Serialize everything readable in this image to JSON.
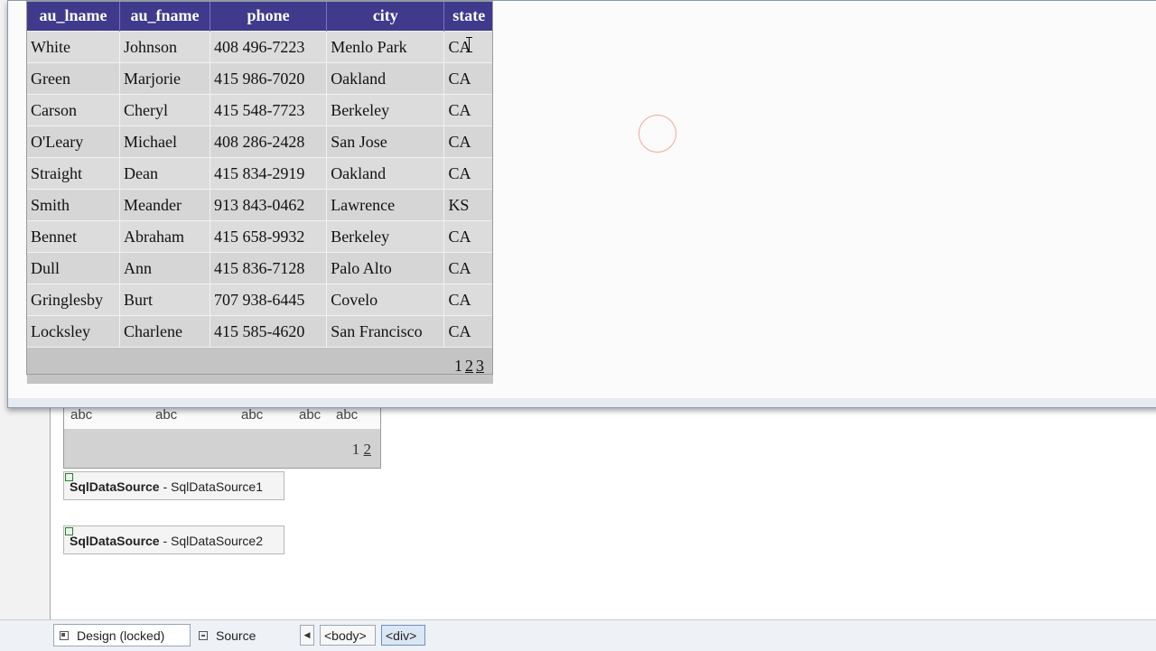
{
  "table": {
    "headers": [
      "au_lname",
      "au_fname",
      "phone",
      "city",
      "state"
    ],
    "rows": [
      [
        "White",
        "Johnson",
        "408 496-7223",
        "Menlo Park",
        "CA"
      ],
      [
        "Green",
        "Marjorie",
        "415 986-7020",
        "Oakland",
        "CA"
      ],
      [
        "Carson",
        "Cheryl",
        "415 548-7723",
        "Berkeley",
        "CA"
      ],
      [
        "O'Leary",
        "Michael",
        "408 286-2428",
        "San Jose",
        "CA"
      ],
      [
        "Straight",
        "Dean",
        "415 834-2919",
        "Oakland",
        "CA"
      ],
      [
        "Smith",
        "Meander",
        "913 843-0462",
        "Lawrence",
        "KS"
      ],
      [
        "Bennet",
        "Abraham",
        "415 658-9932",
        "Berkeley",
        "CA"
      ],
      [
        "Dull",
        "Ann",
        "415 836-7128",
        "Palo Alto",
        "CA"
      ],
      [
        "Gringlesby",
        "Burt",
        "707 938-6445",
        "Covelo",
        "CA"
      ],
      [
        "Locksley",
        "Charlene",
        "415 585-4620",
        "San Francisco",
        "CA"
      ]
    ],
    "pager": {
      "current": "1",
      "links": [
        "2",
        "3"
      ]
    }
  },
  "design_grid": {
    "placeholders": [
      "abc",
      "abc",
      "abc",
      "abc",
      "abc"
    ],
    "pager": {
      "current": "1",
      "links": [
        "2"
      ]
    }
  },
  "datasources": [
    {
      "type": "SqlDataSource",
      "separator": " - ",
      "id": "SqlDataSource1"
    },
    {
      "type": "SqlDataSource",
      "separator": " - ",
      "id": "SqlDataSource2"
    }
  ],
  "bottombar": {
    "design_tab": "Design (locked)",
    "source_tab": "Source",
    "nav_arrow": "◀",
    "breadcrumbs": [
      "<body>",
      "<div>"
    ]
  }
}
